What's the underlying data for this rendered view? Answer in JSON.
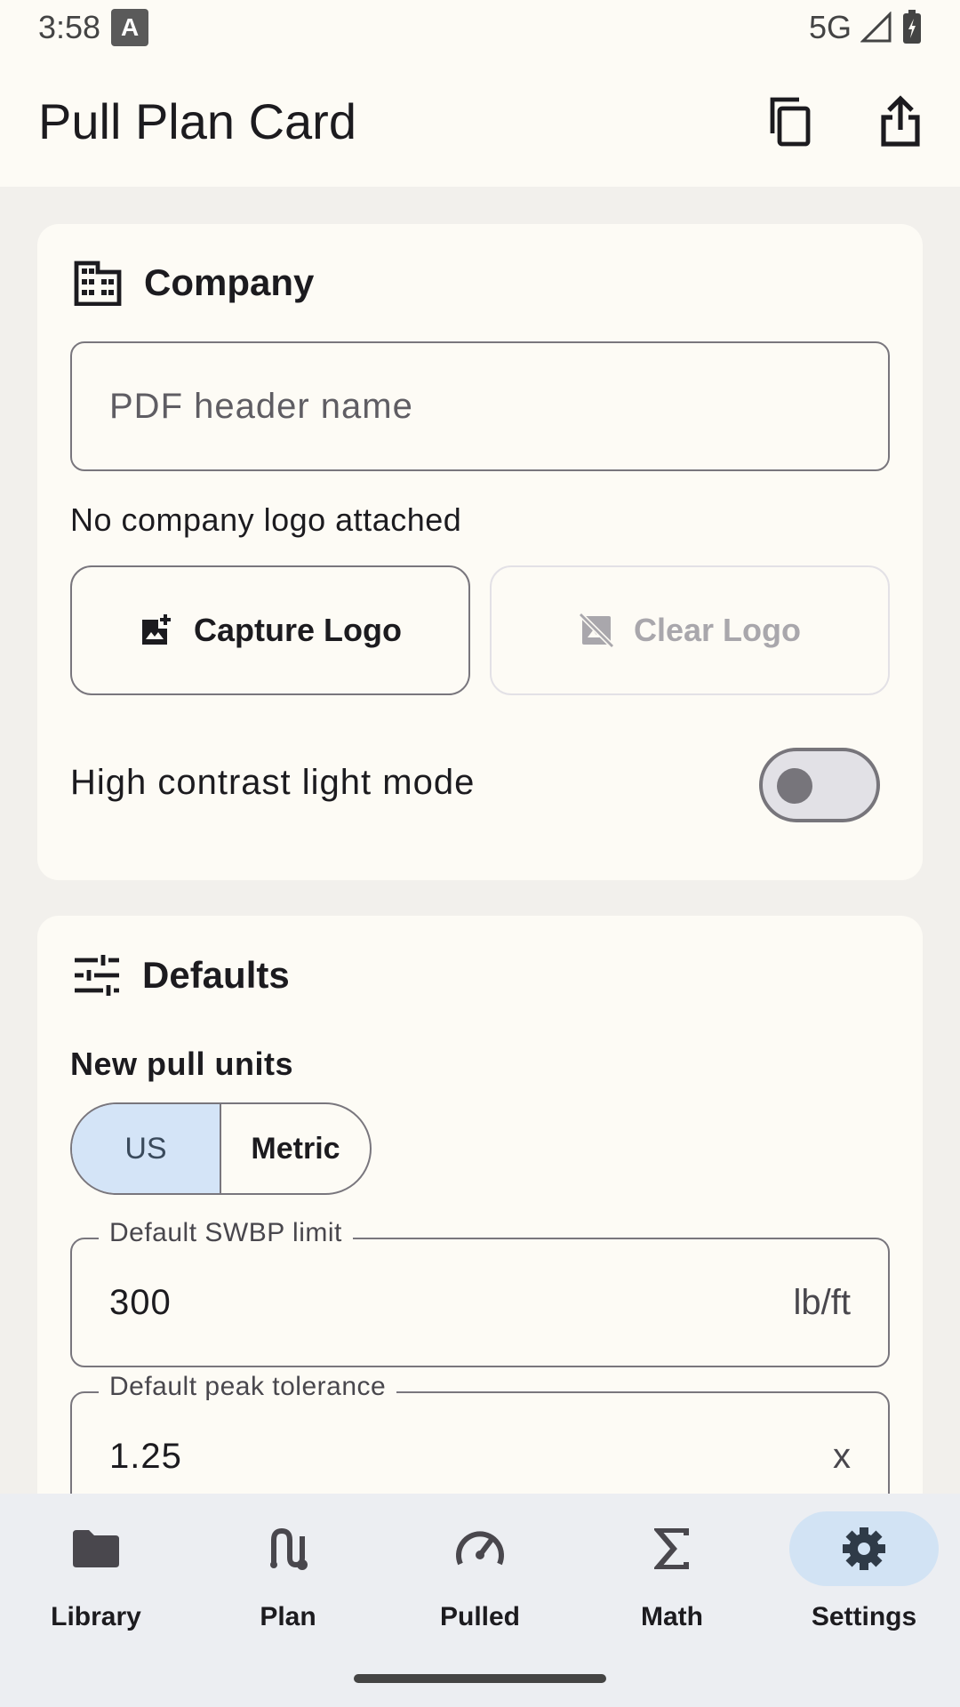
{
  "status": {
    "time": "3:58",
    "network": "5G",
    "notif_icon": "a-icon"
  },
  "appbar": {
    "title": "Pull Plan Card",
    "copy_icon": "copy-icon",
    "share_icon": "share-icon"
  },
  "company": {
    "title": "Company",
    "header_placeholder": "PDF header name",
    "logo_status": "No company logo attached",
    "capture_label": "Capture Logo",
    "clear_label": "Clear Logo",
    "contrast_label": "High contrast light mode",
    "contrast_on": false
  },
  "defaults": {
    "title": "Defaults",
    "units_label": "New pull units",
    "units_options": [
      "US",
      "Metric"
    ],
    "units_selected": "US",
    "swbp": {
      "label": "Default SWBP limit",
      "value": "300",
      "suffix": "lb/ft"
    },
    "peak": {
      "label": "Default peak tolerance",
      "value": "1.25",
      "suffix": "x"
    }
  },
  "nav": {
    "items": [
      {
        "label": "Library",
        "icon": "folder-icon"
      },
      {
        "label": "Plan",
        "icon": "route-icon"
      },
      {
        "label": "Pulled",
        "icon": "speedometer-icon"
      },
      {
        "label": "Math",
        "icon": "sigma-icon"
      },
      {
        "label": "Settings",
        "icon": "gear-icon"
      }
    ],
    "active": "Settings"
  },
  "colors": {
    "accent_selected": "#d4e4f7",
    "background": "#fdfbf5"
  }
}
